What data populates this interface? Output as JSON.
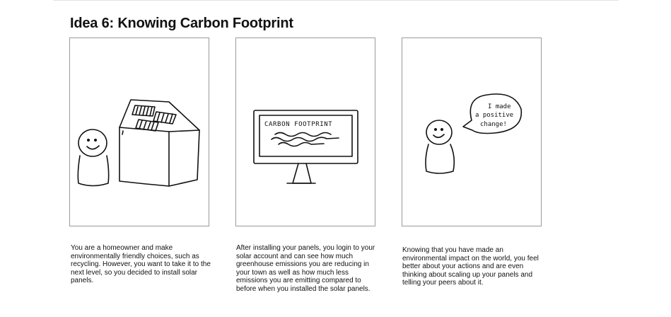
{
  "title": "Idea 6: Knowing Carbon Footprint",
  "panels": [
    {
      "caption": "You are a homeowner and make environmentally friendly choices, such as recycling. However, you want to take it to the next level, so you decided to install solar panels."
    },
    {
      "screen_text": "CARBON FOOTPRINT",
      "caption": "After installing your panels, you login to your solar account and can see how much greenhouse emissions you are reducing in your town as well as how much less emissions you are emitting compared to before when you installed the solar panels."
    },
    {
      "speech": [
        "I made",
        "a positive",
        "change!"
      ],
      "caption": "Knowing that you have made an environmental impact on the world, you feel better about your actions and are even thinking about scaling up your panels and telling your peers about it."
    }
  ]
}
